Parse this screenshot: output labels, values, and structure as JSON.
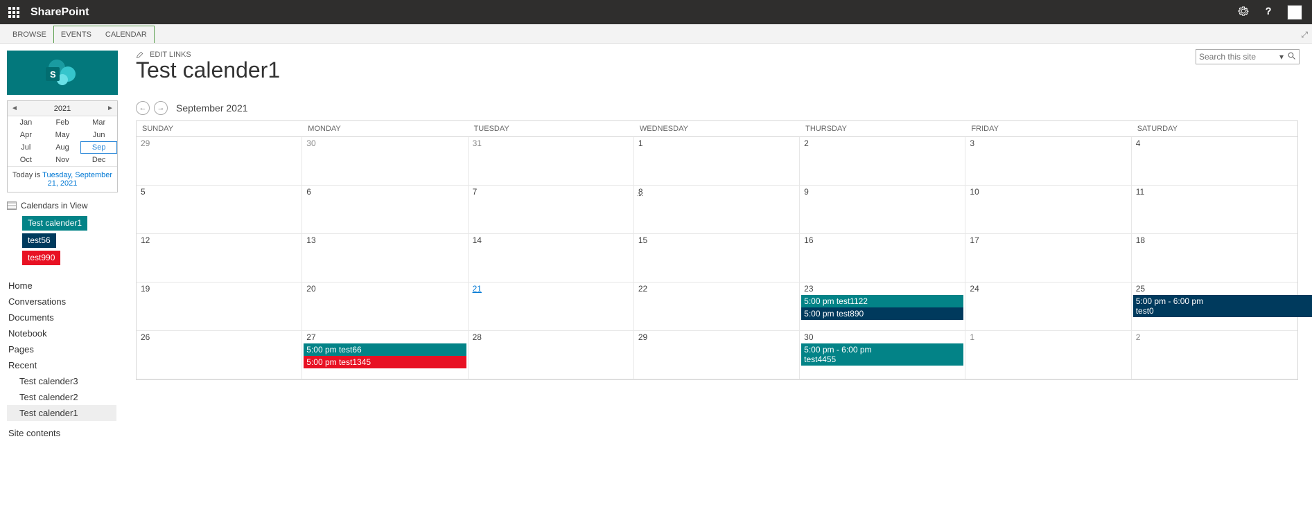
{
  "suitebar": {
    "title": "SharePoint"
  },
  "ribbon": {
    "browse": "BROWSE",
    "events": "EVENTS",
    "calendar": "CALENDAR"
  },
  "yearpicker": {
    "year": "2021",
    "months": [
      "Jan",
      "Feb",
      "Mar",
      "Apr",
      "May",
      "Jun",
      "Jul",
      "Aug",
      "Sep",
      "Oct",
      "Nov",
      "Dec"
    ],
    "selected": "Sep",
    "today_prefix": "Today is ",
    "today_link": "Tuesday, September 21, 2021"
  },
  "calendars_in_view": {
    "label": "Calendars in View",
    "items": [
      {
        "label": "Test calender1",
        "color": "#038387"
      },
      {
        "label": "test56",
        "color": "#003a5d"
      },
      {
        "label": "test990",
        "color": "#e81123"
      }
    ]
  },
  "leftnav": {
    "items": [
      "Home",
      "Conversations",
      "Documents",
      "Notebook",
      "Pages",
      "Recent"
    ],
    "recent_children": [
      "Test calender3",
      "Test calender2",
      "Test calender1"
    ],
    "active_child": "Test calender1",
    "site_contents": "Site contents"
  },
  "page": {
    "edit_links": "EDIT LINKS",
    "title": "Test calender1"
  },
  "search": {
    "placeholder": "Search this site"
  },
  "calendar": {
    "month_label": "September 2021",
    "days": [
      "SUNDAY",
      "MONDAY",
      "TUESDAY",
      "WEDNESDAY",
      "THURSDAY",
      "FRIDAY",
      "SATURDAY"
    ],
    "cells": [
      {
        "n": "29",
        "dim": true
      },
      {
        "n": "30",
        "dim": true
      },
      {
        "n": "31",
        "dim": true
      },
      {
        "n": "1"
      },
      {
        "n": "2"
      },
      {
        "n": "3"
      },
      {
        "n": "4"
      },
      {
        "n": "5"
      },
      {
        "n": "6"
      },
      {
        "n": "7"
      },
      {
        "n": "8",
        "dotted": true
      },
      {
        "n": "9"
      },
      {
        "n": "10"
      },
      {
        "n": "11"
      },
      {
        "n": "12"
      },
      {
        "n": "13"
      },
      {
        "n": "14"
      },
      {
        "n": "15"
      },
      {
        "n": "16"
      },
      {
        "n": "17"
      },
      {
        "n": "18"
      },
      {
        "n": "19"
      },
      {
        "n": "20"
      },
      {
        "n": "21",
        "today": true
      },
      {
        "n": "22"
      },
      {
        "n": "23",
        "events": [
          {
            "text": "5:00 pm test1122",
            "color": "#038387",
            "row": 0
          },
          {
            "text": "5:00 pm test890",
            "color": "#003a5d",
            "row": 1
          }
        ]
      },
      {
        "n": "24"
      },
      {
        "n": "25",
        "events": [
          {
            "text": "5:00 pm - 6:00 pm",
            "text2": "test0",
            "color": "#003a5d",
            "row": 0,
            "span": true
          }
        ]
      },
      {
        "n": "26"
      },
      {
        "n": "27",
        "events": [
          {
            "text": "5:00 pm test66",
            "color": "#038387",
            "row": 0
          },
          {
            "text": "5:00 pm test1345",
            "color": "#e81123",
            "row": 1
          }
        ]
      },
      {
        "n": "28"
      },
      {
        "n": "29"
      },
      {
        "n": "30",
        "events": [
          {
            "text": "5:00 pm - 6:00 pm",
            "text2": "test4455",
            "color": "#038387",
            "row": 0
          }
        ]
      },
      {
        "n": "1",
        "dim": true
      },
      {
        "n": "2",
        "dim": true
      }
    ]
  }
}
